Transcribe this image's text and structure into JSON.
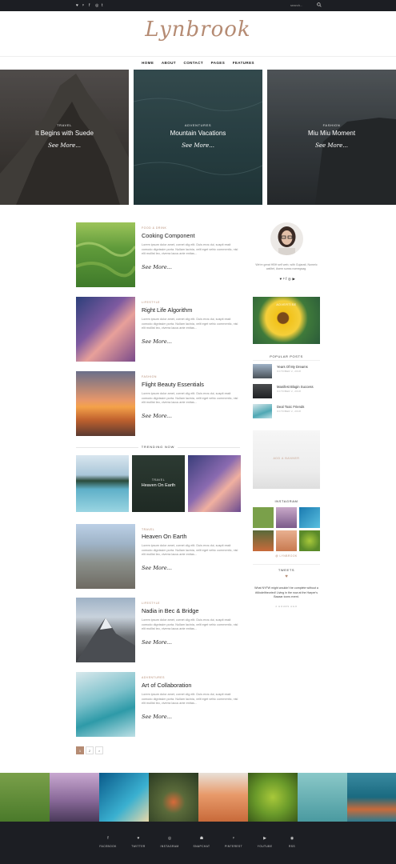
{
  "topbar": {
    "social_icons": [
      "twitter-icon",
      "pinterest-icon",
      "facebook-icon",
      "instagram-icon",
      "tumblr-icon"
    ],
    "social_glyphs": [
      "♥",
      "ᵖ",
      "f",
      "◎",
      "t"
    ],
    "search_placeholder": "search..."
  },
  "logo": "Lynbrook",
  "nav": [
    "HOME",
    "ABOUT",
    "CONTACT",
    "PAGES",
    "FEATURES"
  ],
  "hero": [
    {
      "category": "TRAVEL",
      "title": "It Begins with Suede",
      "more": "See More..."
    },
    {
      "category": "ADVENTURES",
      "title": "Mountain Vacations",
      "more": "See More..."
    },
    {
      "category": "FASHION",
      "title": "Miu Miu Moment",
      "more": "See More..."
    }
  ],
  "posts": [
    {
      "category": "FOOD & DRINK",
      "title": "Cooking Component",
      "body": "Lorem ipsum dolor amet, cornet clig elit. Duis eros dui, suspit essit comodo dignissim porta. Nullam lacinia, velit eget vehic commentic, nisl elit mollist leo, viverra lacus ante enitas...",
      "more": "See More..."
    },
    {
      "category": "LIFESTYLE",
      "title": "Right Life Algorithm",
      "body": "Lorem ipsum dolor amet, cornet clig elit. Duis eros dui, suspit essit comodo dignissim porta. Nullam lacinia, velit eget vehic commentic, nisl elit mollist leo, viverra lacus ante enitas...",
      "more": "See More..."
    },
    {
      "category": "FASHION",
      "title": "Flight Beauty Essentials",
      "body": "Lorem ipsum dolor amet, cornet clig elit. Duis eros dui, suspit essit comodo dignissim porta. Nullam lacinia, velit eget vehic commentic, nisl elit mollist leo, viverra lacus ante enitas...",
      "more": "See More..."
    },
    {
      "category": "TRAVEL",
      "title": "Heaven On Earth",
      "body": "Lorem ipsum dolor amet, cornet clig elit. Duis eros dui, suspit essit comodo dignissim porta. Nullam lacinia, velit eget vehic commentic, nisl elit mollist leo, viverra lacus ante enitas...",
      "more": "See More..."
    },
    {
      "category": "LIFESTYLE",
      "title": "Nadia in Bec & Bridge",
      "body": "Lorem ipsum dolor amet, cornet clig elit. Duis eros dui, suspit essit comodo dignissim porta. Nullam lacinia, velit eget vehic commentic, nisl elit mollist leo, viverra lacus ante enitas...",
      "more": "See More..."
    },
    {
      "category": "ADVENTURES",
      "title": "Art of Collaboration",
      "body": "Lorem ipsum dolor amet, cornet clig elit. Duis eros dui, suspit essit comodo dignissim porta. Nullam lacinia, velit eget vehic commentic, nisl elit mollist leo, viverra lacus ante enitas...",
      "more": "See More..."
    }
  ],
  "trending": {
    "label": "TRENDING NOW",
    "featured_category": "TRAVEL",
    "featured_title": "Heaven On Earth"
  },
  "sidebar": {
    "about_text": "We're great HBH self web, with Gujarati, Nomeic walltet, Asem sunss nomegsag.",
    "about_social_glyphs": [
      "♥",
      "ᵖ",
      "f",
      "◎",
      "▶"
    ],
    "ad_label": "ADVERTISE",
    "popular_label": "POPULAR POSTS",
    "popular": [
      {
        "title": "Years Of My Dreams",
        "date": "OCTOBER 2, 2018"
      },
      {
        "title": "Manifest Blogin Success",
        "date": "OCTOBER 2, 2018"
      },
      {
        "title": "Deal Toxic Friends",
        "date": "OCTOBER 2, 2018"
      }
    ],
    "ad2_label": "ADD A BANNER",
    "instagram_label": "INSTAGRAM",
    "instagram_handle": "@ LYNBROOK",
    "tweets_label": "TWEETS",
    "tweet_text": "What NYFW might wouldn't be complete without a #Modeltheoried! Living in the now at the Harper's Bazaar icons event.",
    "tweet_time": "2 HOURS AGO"
  },
  "pagination": [
    "1",
    "2",
    ">"
  ],
  "footer": [
    {
      "icon": "facebook-icon",
      "glyph": "f",
      "label": "FACEBOOK"
    },
    {
      "icon": "twitter-icon",
      "glyph": "♥",
      "label": "TWITTER"
    },
    {
      "icon": "instagram-icon",
      "glyph": "◎",
      "label": "INSTAGRAM"
    },
    {
      "icon": "snapchat-icon",
      "glyph": "☗",
      "label": "SNAPCHAT"
    },
    {
      "icon": "pinterest-icon",
      "glyph": "ᵖ",
      "label": "PINTEREST"
    },
    {
      "icon": "youtube-icon",
      "glyph": "▶",
      "label": "YOUTUBE"
    },
    {
      "icon": "rss-icon",
      "glyph": "◉",
      "label": "RSS"
    }
  ],
  "colors": {
    "accent": "#b58b73",
    "dark": "#1c1e23"
  }
}
